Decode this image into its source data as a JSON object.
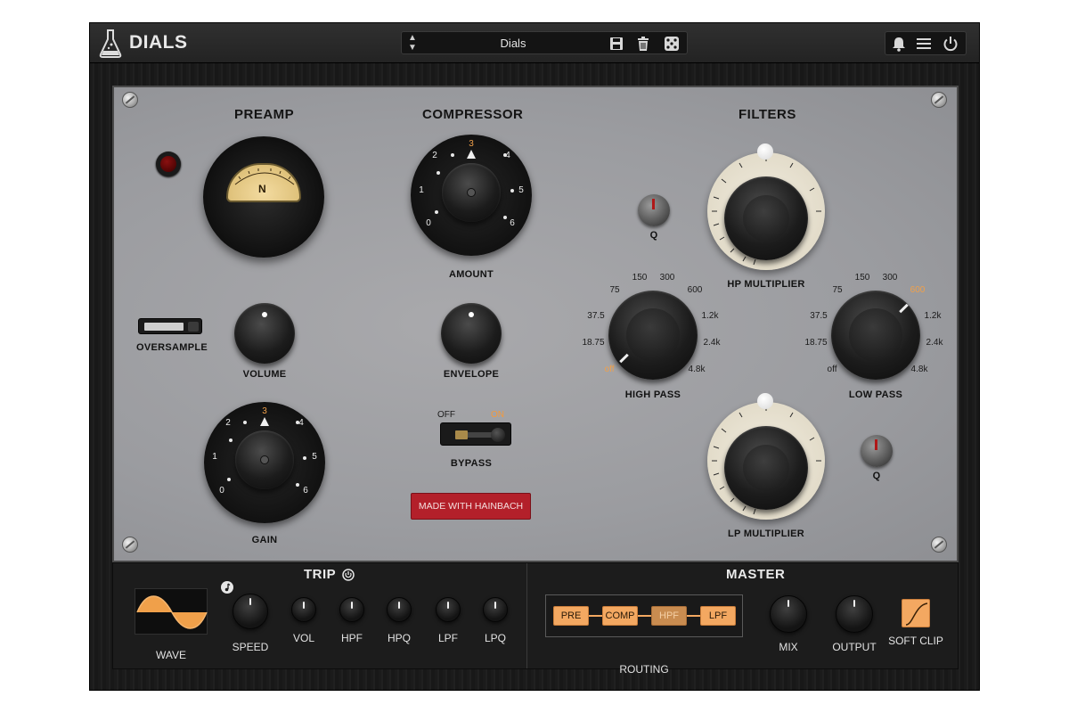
{
  "app": {
    "title": "DIALS"
  },
  "toolbar": {
    "preset_name": "Dials",
    "icons": [
      "preset-arrows-icon",
      "save-icon",
      "trash-icon",
      "dice-icon",
      "bell-icon",
      "menu-icon",
      "power-icon"
    ]
  },
  "preamp": {
    "title": "PREAMP",
    "vu_letter": "N",
    "oversample_label": "OVERSAMPLE",
    "volume_label": "VOLUME",
    "gain_label": "GAIN",
    "gain_ticks": [
      "0",
      "1",
      "2",
      "3",
      "4",
      "5",
      "6"
    ],
    "gain_value": "3"
  },
  "compressor": {
    "title": "COMPRESSOR",
    "amount_label": "AMOUNT",
    "amount_ticks": [
      "0",
      "1",
      "2",
      "3",
      "4",
      "5",
      "6"
    ],
    "amount_value": "3",
    "envelope_label": "ENVELOPE",
    "bypass_label": "BYPASS",
    "bypass_off": "OFF",
    "bypass_on": "ON",
    "made_with": "MADE WITH HAINBACH"
  },
  "filters": {
    "title": "FILTERS",
    "q_label": "Q",
    "hp_multiplier_label": "HP MULTIPLIER",
    "lp_multiplier_label": "LP MULTIPLIER",
    "high_pass_label": "HIGH PASS",
    "low_pass_label": "LOW PASS",
    "freq_ticks": [
      "off",
      "18.75",
      "37.5",
      "75",
      "150",
      "300",
      "600",
      "1.2k",
      "2.4k",
      "4.8k"
    ],
    "high_pass_value": "off",
    "low_pass_value": "600"
  },
  "trip": {
    "title": "TRIP",
    "wave_label": "WAVE",
    "speed_label": "SPEED",
    "knobs": [
      "VOL",
      "HPF",
      "HPQ",
      "LPF",
      "LPQ"
    ]
  },
  "master": {
    "title": "MASTER",
    "routing_label": "ROUTING",
    "routing": [
      "PRE",
      "COMP",
      "HPF",
      "LPF"
    ],
    "mix_label": "MIX",
    "output_label": "OUTPUT",
    "soft_clip_label": "SOFT CLIP"
  },
  "colors": {
    "accent": "#f3a861",
    "badge": "#b3202a",
    "panel": "#9c9da1"
  }
}
